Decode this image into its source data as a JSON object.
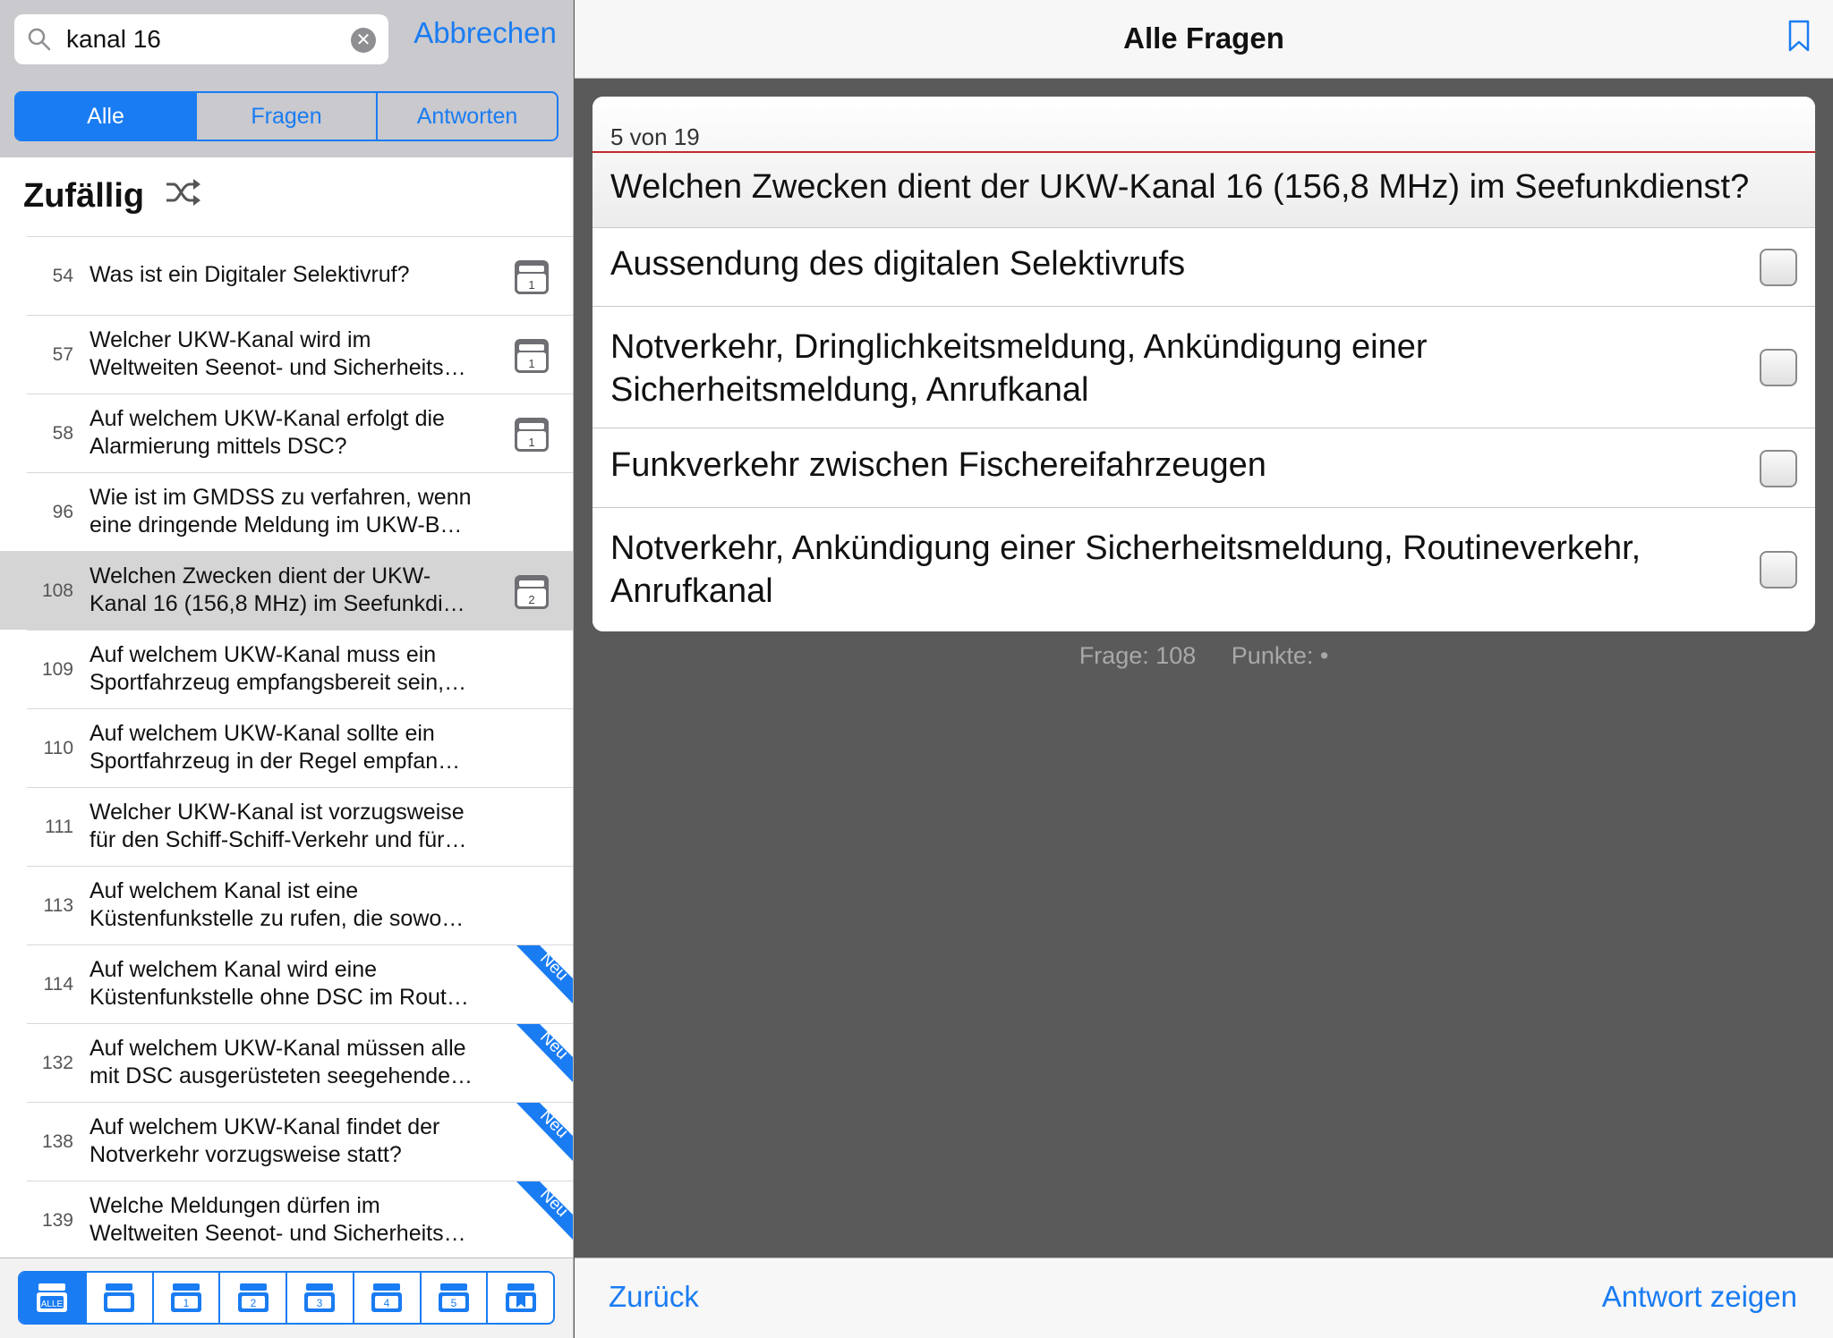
{
  "search": {
    "value": "kanal 16",
    "cancel_label": "Abbrechen"
  },
  "segments": [
    {
      "label": "Alle",
      "active": true
    },
    {
      "label": "Fragen",
      "active": false
    },
    {
      "label": "Antworten",
      "active": false
    }
  ],
  "section": {
    "title": "Zufällig"
  },
  "list": [
    {
      "num": "54",
      "line1": "Was ist ein Digitaler Selektivruf?",
      "line2": "",
      "box": "1",
      "neu": false,
      "selected": false
    },
    {
      "num": "57",
      "line1": "Welcher UKW-Kanal wird im",
      "line2": "Weltweiten Seenot- und Sicherheits…",
      "box": "1",
      "neu": false,
      "selected": false
    },
    {
      "num": "58",
      "line1": "Auf welchem UKW-Kanal erfolgt die",
      "line2": "Alarmierung mittels DSC?",
      "box": "1",
      "neu": false,
      "selected": false
    },
    {
      "num": "96",
      "line1": "Wie ist im GMDSS zu verfahren, wenn",
      "line2": "eine dringende Meldung im UKW-B…",
      "box": "",
      "neu": false,
      "selected": false
    },
    {
      "num": "108",
      "line1": "Welchen Zwecken dient der UKW-",
      "line2": "Kanal 16 (156,8 MHz) im Seefunkdi…",
      "box": "2",
      "neu": false,
      "selected": true
    },
    {
      "num": "109",
      "line1": "Auf welchem UKW-Kanal muss ein",
      "line2": "Sportfahrzeug empfangsbereit sein,…",
      "box": "",
      "neu": false,
      "selected": false
    },
    {
      "num": "110",
      "line1": "Auf welchem UKW-Kanal sollte ein",
      "line2": "Sportfahrzeug in der Regel empfan…",
      "box": "",
      "neu": false,
      "selected": false
    },
    {
      "num": "111",
      "line1": "Welcher UKW-Kanal ist vorzugsweise",
      "line2": "für den Schiff-Schiff-Verkehr und für…",
      "box": "",
      "neu": false,
      "selected": false
    },
    {
      "num": "113",
      "line1": "Auf welchem Kanal ist eine",
      "line2": "Küstenfunkstelle zu rufen, die sowo…",
      "box": "",
      "neu": false,
      "selected": false
    },
    {
      "num": "114",
      "line1": "Auf welchem Kanal wird eine",
      "line2": "Küstenfunkstelle ohne DSC im Rout…",
      "box": "",
      "neu": true,
      "selected": false
    },
    {
      "num": "132",
      "line1": "Auf welchem UKW-Kanal müssen alle",
      "line2": "mit DSC ausgerüsteten seegehende…",
      "box": "",
      "neu": true,
      "selected": false
    },
    {
      "num": "138",
      "line1": "Auf welchem UKW-Kanal findet der",
      "line2": "Notverkehr vorzugsweise statt?",
      "box": "",
      "neu": true,
      "selected": false
    },
    {
      "num": "139",
      "line1": "Welche Meldungen dürfen im",
      "line2": "Weltweiten Seenot- und Sicherheits…",
      "box": "",
      "neu": true,
      "selected": false
    }
  ],
  "neu_label": "Neu",
  "tabbar": [
    {
      "label": "ALLE",
      "icon": "all-boxes-icon",
      "active": true
    },
    {
      "label": "",
      "icon": "box-icon",
      "active": false
    },
    {
      "label": "1",
      "icon": "box-1-icon",
      "active": false
    },
    {
      "label": "2",
      "icon": "box-2-icon",
      "active": false
    },
    {
      "label": "3",
      "icon": "box-3-icon",
      "active": false
    },
    {
      "label": "4",
      "icon": "box-4-icon",
      "active": false
    },
    {
      "label": "5",
      "icon": "box-5-icon",
      "active": false
    },
    {
      "label": "",
      "icon": "bookmark-box-icon",
      "active": false
    }
  ],
  "navbar": {
    "title": "Alle Fragen"
  },
  "card": {
    "counter": "5 von 19",
    "question": "Welchen Zwecken dient der UKW-Kanal 16 (156,8 MHz) im Seefunkdienst?",
    "answers": [
      {
        "line1": "Aussendung des digitalen Selektivrufs",
        "line2": ""
      },
      {
        "line1": "Notverkehr, Dringlichkeitsmeldung, Ankündigung einer",
        "line2": "Sicherheitsmeldung, Anrufkanal"
      },
      {
        "line1": "Funkverkehr zwischen Fischereifahrzeugen",
        "line2": ""
      },
      {
        "line1": "Notverkehr, Ankündigung einer Sicherheitsmeldung, Routineverkehr,",
        "line2": "Anrufkanal"
      }
    ]
  },
  "meta": {
    "frage": "Frage: 108",
    "punkte": "Punkte: •"
  },
  "bottombar": {
    "back_label": "Zurück",
    "show_answer_label": "Antwort zeigen"
  },
  "colors": {
    "accent": "#1a7cf2",
    "divider_red": "#c42b2b",
    "background": "#5a5a5a"
  }
}
